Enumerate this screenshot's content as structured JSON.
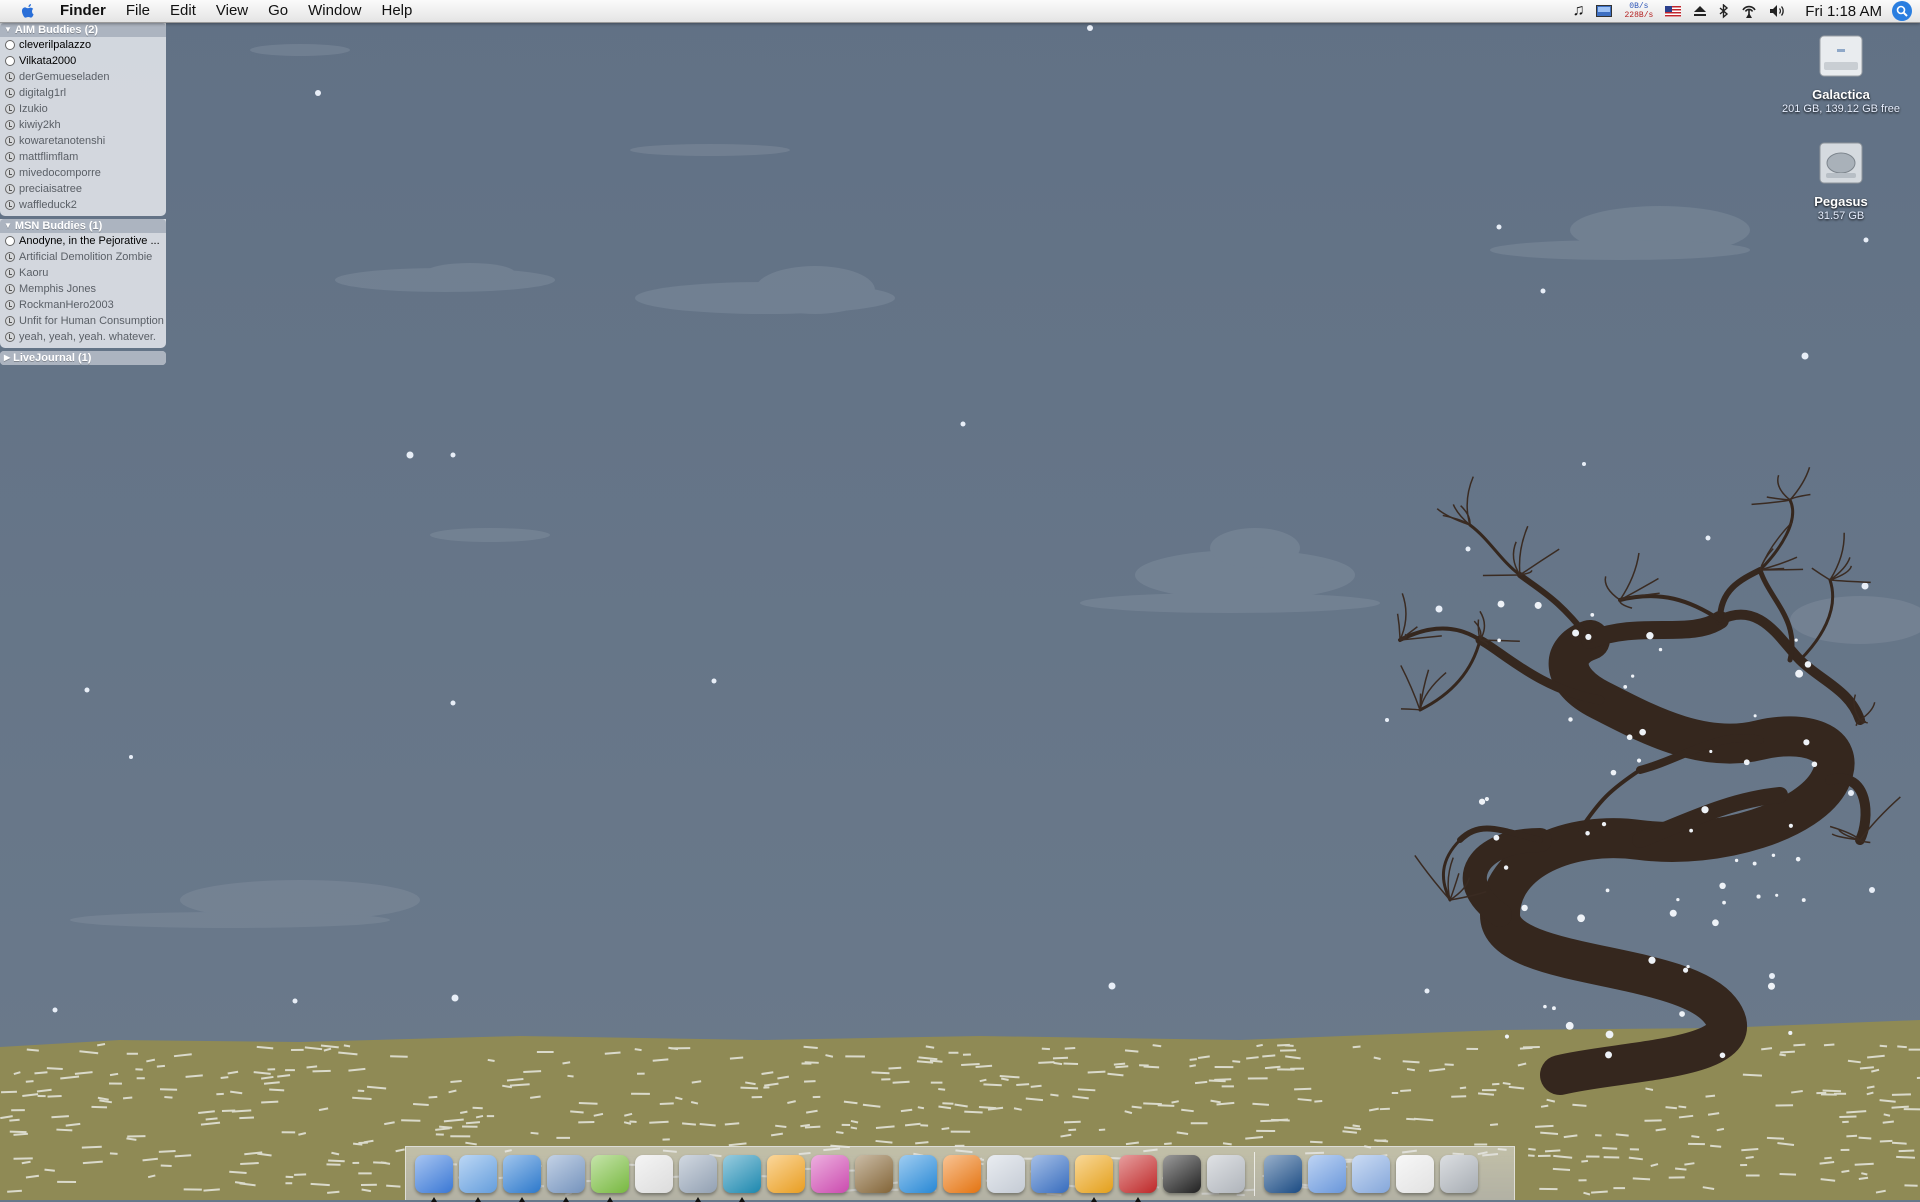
{
  "menubar": {
    "app_name": "Finder",
    "menus": [
      "File",
      "Edit",
      "View",
      "Go",
      "Window",
      "Help"
    ],
    "extras": [
      "itunes-note-icon",
      "display-icon",
      "net-monitor",
      "us-flag-icon",
      "eject-icon",
      "bluetooth-icon",
      "airport-icon",
      "volume-icon"
    ],
    "net_up": "0B/s",
    "net_down": "228B/s",
    "clock": "Fri 1:18 AM"
  },
  "buddy_list": {
    "aim": {
      "header": "AIM Buddies (2)",
      "buddies": [
        {
          "name": "cleverilpalazzo",
          "status": "online"
        },
        {
          "name": "Vilkata2000",
          "status": "online"
        },
        {
          "name": "derGemueseladen",
          "status": "away"
        },
        {
          "name": "digitalg1rl",
          "status": "away"
        },
        {
          "name": "Izukio",
          "status": "away"
        },
        {
          "name": "kiwiy2kh",
          "status": "away"
        },
        {
          "name": "kowaretanotenshi",
          "status": "away"
        },
        {
          "name": "mattflimflam",
          "status": "away"
        },
        {
          "name": "mivedocomporre",
          "status": "away"
        },
        {
          "name": "preciaisatree",
          "status": "away"
        },
        {
          "name": "waffleduck2",
          "status": "away"
        }
      ]
    },
    "msn": {
      "header": "MSN Buddies (1)",
      "buddies": [
        {
          "name": "Anodyne, in the Pejorative ...",
          "status": "online"
        },
        {
          "name": "Artificial Demolition Zombie",
          "status": "away"
        },
        {
          "name": "Kaoru",
          "status": "away"
        },
        {
          "name": "Memphis Jones",
          "status": "away"
        },
        {
          "name": "RockmanHero2003",
          "status": "away"
        },
        {
          "name": "Unfit for Human Consumption",
          "status": "away"
        },
        {
          "name": "yeah, yeah, yeah.  whatever.",
          "status": "away"
        }
      ]
    },
    "livejournal": {
      "header": "LiveJournal (1)"
    }
  },
  "desktop_icons": [
    {
      "name": "Galactica",
      "info": "201 GB, 139.12 GB free"
    },
    {
      "name": "Pegasus",
      "info": "31.57 GB"
    }
  ],
  "dock": {
    "apps": [
      {
        "icon": "finder-icon",
        "running": true,
        "color": "#3d7ee0"
      },
      {
        "icon": "itunes-icon",
        "running": true,
        "color": "#6aa6e8"
      },
      {
        "icon": "safari-icon",
        "running": true,
        "color": "#2f7fd6"
      },
      {
        "icon": "mail-icon",
        "running": true,
        "color": "#7b9bc7"
      },
      {
        "icon": "adium-duck-icon",
        "running": true,
        "color": "#7ec243"
      },
      {
        "icon": "textedit-icon",
        "running": false,
        "color": "#e8e8e8"
      },
      {
        "icon": "preview-icon",
        "running": true,
        "color": "#9aa9bc"
      },
      {
        "icon": "quill-feather-icon",
        "running": true,
        "color": "#1e8fb8"
      },
      {
        "icon": "iphoto-flower-icon",
        "running": false,
        "color": "#f5a623"
      },
      {
        "icon": "butterfly-icon",
        "running": false,
        "color": "#d64fb8"
      },
      {
        "icon": "photo-booth-icon",
        "running": false,
        "color": "#8a6a3a"
      },
      {
        "icon": "quicktime-icon",
        "running": false,
        "color": "#2a8fe0"
      },
      {
        "icon": "vlc-cone-icon",
        "running": false,
        "color": "#f07a12"
      },
      {
        "icon": "printer-icon",
        "running": false,
        "color": "#cfd6e0"
      },
      {
        "icon": "delivery-truck-icon",
        "running": false,
        "color": "#3a72c8"
      },
      {
        "icon": "transmit-icon",
        "running": true,
        "color": "#f0a81c"
      },
      {
        "icon": "red-app-icon",
        "running": true,
        "color": "#c82a2a"
      },
      {
        "icon": "activity-monitor-icon",
        "running": false,
        "color": "#222"
      },
      {
        "icon": "system-info-icon",
        "running": false,
        "color": "#b9bec5"
      }
    ],
    "stacks": [
      {
        "icon": "dashboard-up-icon",
        "color": "#1c4f8a"
      },
      {
        "icon": "applications-folder-icon",
        "color": "#6f9fe6"
      },
      {
        "icon": "downloads-folder-icon",
        "color": "#8cb0e6"
      },
      {
        "icon": "documents-icon",
        "color": "#eeeeee"
      },
      {
        "icon": "trash-icon",
        "color": "#b0b6bd"
      }
    ]
  },
  "colors": {
    "sky": "#66778a",
    "ground": "#8f8a55",
    "tree": "#3a2b22"
  }
}
